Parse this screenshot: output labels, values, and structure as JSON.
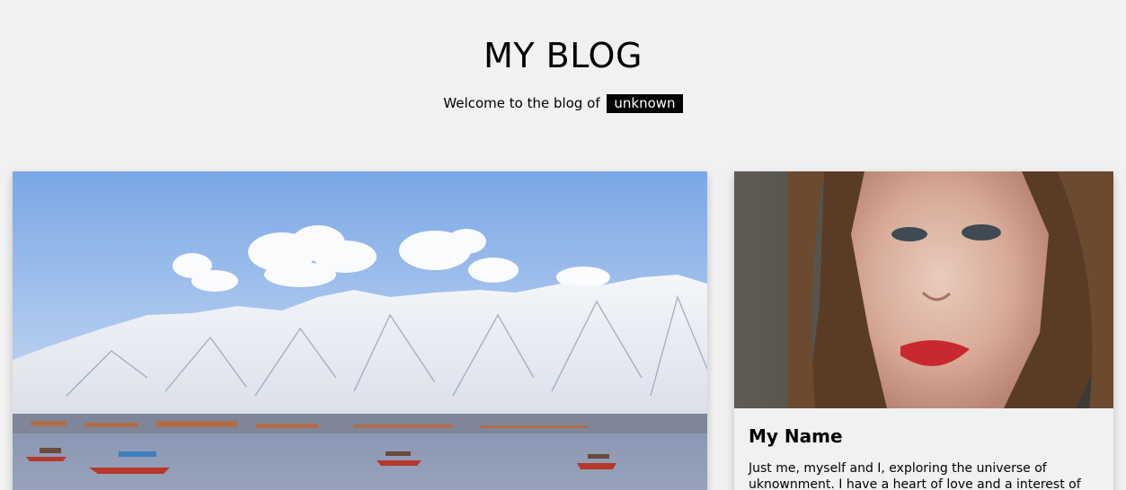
{
  "header": {
    "title": "MY BLOG",
    "tagline": "Welcome to the blog of",
    "author": "unknown"
  },
  "post": {
    "image_alt": "Snow-capped mountains above a lake with shikara boats"
  },
  "about": {
    "name": "My Name",
    "bio": "Just me, myself and I, exploring the universe of uknownment. I have a heart of love and a interest of"
  },
  "colors": {
    "background": "#f1f1f1",
    "badge_bg": "#000000",
    "badge_text": "#ffffff"
  }
}
